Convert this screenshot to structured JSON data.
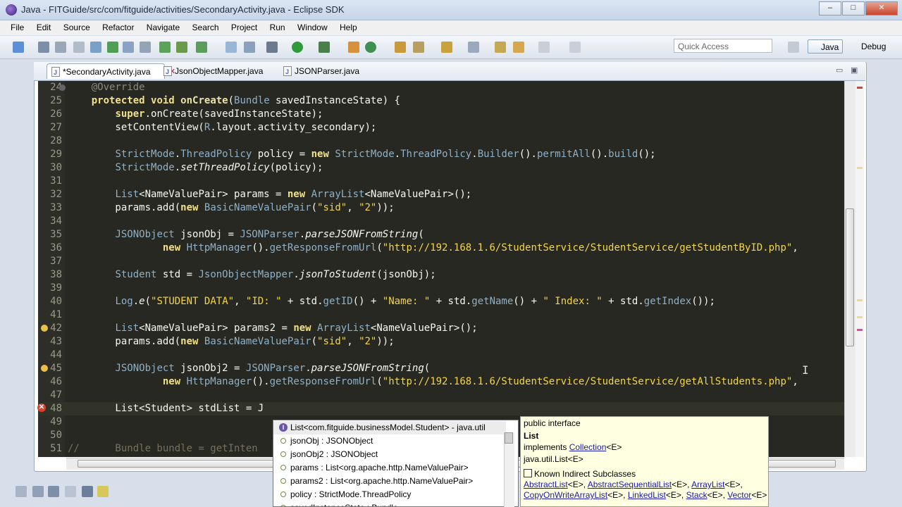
{
  "window": {
    "title": "Java - FITGuide/src/com/fitguide/activities/SecondaryActivity.java - Eclipse SDK",
    "minimize": "–",
    "maximize": "□",
    "close": "✕"
  },
  "menu": [
    "File",
    "Edit",
    "Source",
    "Refactor",
    "Navigate",
    "Search",
    "Project",
    "Run",
    "Window",
    "Help"
  ],
  "toolbar": {
    "quick_access": "Quick Access",
    "perspective_java": "Java",
    "perspective_debug": "Debug"
  },
  "tabs": [
    {
      "label": "*SecondaryActivity.java",
      "active": true
    },
    {
      "label": "JsonObjectMapper.java",
      "active": false
    },
    {
      "label": "JSONParser.java",
      "active": false
    }
  ],
  "code": {
    "lines": [
      {
        "n": "24",
        "html": "    <span class=\"ann\">@Override</span>"
      },
      {
        "n": "25",
        "html": "    <span class=\"kw\">protected</span> <span class=\"kw\">void</span> <span class=\"fn\"><b>onCreate</b></span>(<span class=\"ty\">Bundle</span> savedInstanceState) {"
      },
      {
        "n": "26",
        "html": "        <span class=\"kw\">super</span>.onCreate(savedInstanceState);"
      },
      {
        "n": "27",
        "html": "        setContentView(<span class=\"ty\">R</span>.layout.activity_secondary);"
      },
      {
        "n": "28",
        "html": ""
      },
      {
        "n": "29",
        "html": "        <span class=\"ty\">StrictMode</span>.<span class=\"ty\">ThreadPolicy</span> policy = <span class=\"kw\">new</span> <span class=\"ty\">StrictMode</span>.<span class=\"ty\">ThreadPolicy</span>.<span class=\"ty\">Builder</span>().<span class=\"ty\">permitAll</span>().<span class=\"ty\">build</span>();"
      },
      {
        "n": "30",
        "html": "        <span class=\"ty\">StrictMode</span>.<span class=\"it\">setThreadPolicy</span>(policy);"
      },
      {
        "n": "31",
        "html": ""
      },
      {
        "n": "32",
        "html": "        <span class=\"ty\">List</span>&lt;NameValuePair&gt; params = <span class=\"kw\">new</span> <span class=\"ty\">ArrayList</span>&lt;NameValuePair&gt;();"
      },
      {
        "n": "33",
        "html": "        params.add(<span class=\"kw\">new</span> <span class=\"ty\">BasicNameValuePair</span>(<span class=\"str\">\"sid\"</span>, <span class=\"str\">\"2\"</span>));"
      },
      {
        "n": "34",
        "html": ""
      },
      {
        "n": "35",
        "html": "        <span class=\"ty\">JSONObject</span> jsonObj = <span class=\"ty\">JSONParser</span>.<span class=\"it\">parseJSONFromString</span>("
      },
      {
        "n": "36",
        "html": "                <span class=\"kw\">new</span> <span class=\"ty\">HttpManager</span>().<span class=\"ty\">getResponseFromUrl</span>(<span class=\"str\">\"http://192.168.1.6/StudentService/StudentService/getStudentByID.php\"</span>,"
      },
      {
        "n": "37",
        "html": ""
      },
      {
        "n": "38",
        "html": "        <span class=\"ty\">Student</span> std = <span class=\"ty\">JsonObjectMapper</span>.<span class=\"it\">jsonToStudent</span>(jsonObj);"
      },
      {
        "n": "39",
        "html": ""
      },
      {
        "n": "40",
        "html": "        <span class=\"ty\">Log</span>.<span class=\"it\">e</span>(<span class=\"str\">\"STUDENT DATA\"</span>, <span class=\"str\">\"ID: \"</span> + std.<span class=\"ty\">getID</span>() + <span class=\"str\">\"Name: \"</span> + std.<span class=\"ty\">getName</span>() + <span class=\"str\">\" Index: \"</span> + std.<span class=\"ty\">getIndex</span>());"
      },
      {
        "n": "41",
        "html": ""
      },
      {
        "n": "42",
        "html": "        <span class=\"ty\">List</span>&lt;NameValuePair&gt; params2 = <span class=\"kw\">new</span> <span class=\"ty\">ArrayList</span>&lt;NameValuePair&gt;();"
      },
      {
        "n": "43",
        "html": "        params.add(<span class=\"kw\">new</span> <span class=\"ty\">BasicNameValuePair</span>(<span class=\"str\">\"sid\"</span>, <span class=\"str\">\"2\"</span>));"
      },
      {
        "n": "44",
        "html": ""
      },
      {
        "n": "45",
        "html": "        <span class=\"ty\">JSONObject</span> jsonObj2 = <span class=\"ty\">JSONParser</span>.<span class=\"it\">parseJSONFromString</span>("
      },
      {
        "n": "46",
        "html": "                <span class=\"kw\">new</span> <span class=\"ty\">HttpManager</span>().<span class=\"ty\">getResponseFromUrl</span>(<span class=\"str\">\"http://192.168.1.6/StudentService/StudentService/getAllStudents.php\"</span>,"
      },
      {
        "n": "47",
        "html": ""
      },
      {
        "n": "48",
        "html": "        List&lt;Student&gt; stdList = J"
      },
      {
        "n": "49",
        "html": ""
      },
      {
        "n": "50",
        "html": ""
      },
      {
        "n": "51",
        "html": "<span class=\"cm\">//      Bundle bundle = getInten</span>"
      }
    ]
  },
  "assist": {
    "items": [
      {
        "label": "List<com.fitguide.businessModel.Student> - java.util",
        "kind": "interface",
        "selected": true
      },
      {
        "label": "jsonObj : JSONObject",
        "kind": "local"
      },
      {
        "label": "jsonObj2 : JSONObject",
        "kind": "local"
      },
      {
        "label": "params : List<org.apache.http.NameValuePair>",
        "kind": "local"
      },
      {
        "label": "params2 : List<org.apache.http.NameValuePair>",
        "kind": "local"
      },
      {
        "label": "policy : StrictMode.ThreadPolicy",
        "kind": "local"
      },
      {
        "label": "savedInstanceState : Bundle",
        "kind": "local"
      }
    ]
  },
  "javadoc": {
    "line1": "public interface",
    "line2": "List",
    "implements_prefix": "implements ",
    "implements_link": "Collection",
    "implements_suffix": "<E>",
    "line4": "java.util.List<E>",
    "known_heading": "Known Indirect Subclasses",
    "subclasses_row1": [
      {
        "link": "AbstractList",
        "suffix": "<E>, "
      },
      {
        "link": "AbstractSequentialList",
        "suffix": "<E>, "
      },
      {
        "link": "ArrayList",
        "suffix": "<E>,"
      }
    ],
    "subclasses_row2": [
      {
        "link": "CopyOnWriteArrayList",
        "suffix": "<E>, "
      },
      {
        "link": "LinkedList",
        "suffix": "<E>, "
      },
      {
        "link": "Stack",
        "suffix": "<E>, "
      },
      {
        "link": "Vector",
        "suffix": "<E>"
      }
    ]
  }
}
